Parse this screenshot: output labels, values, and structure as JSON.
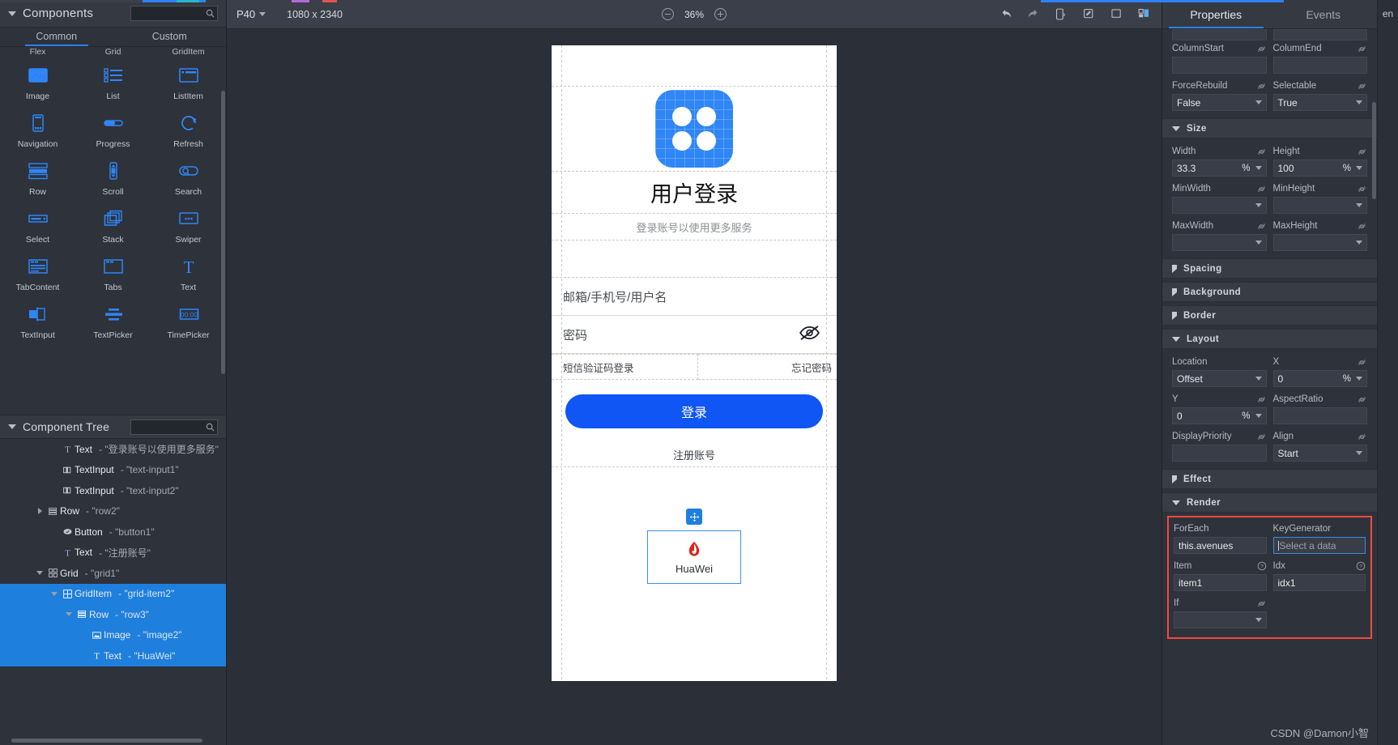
{
  "left_panel": {
    "components_title": "Components",
    "components_search_placeholder": "",
    "tabs": {
      "common": "Common",
      "custom": "Custom"
    },
    "row_labels": [
      "Flex",
      "Grid",
      "GridItem"
    ],
    "palette": [
      {
        "label": "Image",
        "icon": "image-icon"
      },
      {
        "label": "List",
        "icon": "list-icon"
      },
      {
        "label": "ListItem",
        "icon": "listitem-icon"
      },
      {
        "label": "Navigation",
        "icon": "navigation-icon"
      },
      {
        "label": "Progress",
        "icon": "progress-icon"
      },
      {
        "label": "Refresh",
        "icon": "refresh-icon"
      },
      {
        "label": "Row",
        "icon": "row-icon"
      },
      {
        "label": "Scroll",
        "icon": "scroll-icon"
      },
      {
        "label": "Search",
        "icon": "search-icon"
      },
      {
        "label": "Select",
        "icon": "select-icon"
      },
      {
        "label": "Stack",
        "icon": "stack-icon"
      },
      {
        "label": "Swiper",
        "icon": "swiper-icon"
      },
      {
        "label": "TabContent",
        "icon": "tabcontent-icon"
      },
      {
        "label": "Tabs",
        "icon": "tabs-icon"
      },
      {
        "label": "Text",
        "icon": "text-icon"
      },
      {
        "label": "TextInput",
        "icon": "textinput-icon"
      },
      {
        "label": "TextPicker",
        "icon": "textpicker-icon"
      },
      {
        "label": "TimePicker",
        "icon": "timepicker-icon"
      }
    ],
    "tree_title": "Component Tree",
    "tree_search_placeholder": "",
    "tree": [
      {
        "type": "Text",
        "value": "- \"登录账号以使用更多服务\"",
        "indent": 3,
        "caret": "",
        "icon": "text-icon",
        "selected": false
      },
      {
        "type": "TextInput",
        "value": "- \"text-input1\"",
        "indent": 3,
        "caret": "",
        "icon": "textinput-icon",
        "selected": false
      },
      {
        "type": "TextInput",
        "value": "- \"text-input2\"",
        "indent": 3,
        "caret": "",
        "icon": "textinput-icon",
        "selected": false
      },
      {
        "type": "Row",
        "value": "- \"row2\"",
        "indent": 2,
        "caret": "right",
        "icon": "row-icon",
        "selected": false
      },
      {
        "type": "Button",
        "value": "- \"button1\"",
        "indent": 3,
        "caret": "",
        "icon": "button-icon",
        "selected": false
      },
      {
        "type": "Text",
        "value": "- \"注册账号\"",
        "indent": 3,
        "caret": "",
        "icon": "text-icon",
        "selected": false
      },
      {
        "type": "Grid",
        "value": "- \"grid1\"",
        "indent": 2,
        "caret": "down",
        "icon": "grid-icon",
        "selected": false
      },
      {
        "type": "GridItem",
        "value": "- \"grid-item2\"",
        "indent": 3,
        "caret": "down",
        "icon": "griditem-icon",
        "selected": true
      },
      {
        "type": "Row",
        "value": "- \"row3\"",
        "indent": 4,
        "caret": "down",
        "icon": "row-icon",
        "selected": true
      },
      {
        "type": "Image",
        "value": "- \"image2\"",
        "indent": 5,
        "caret": "",
        "icon": "image-icon",
        "selected": true
      },
      {
        "type": "Text",
        "value": "- \"HuaWei\"",
        "indent": 5,
        "caret": "",
        "icon": "text-icon",
        "selected": true
      }
    ]
  },
  "toolbar": {
    "device": "P40",
    "resolution": "1080 x 2340",
    "zoom": "36%",
    "icons": [
      "undo-icon",
      "redo-icon",
      "device-preview-icon",
      "link-device-icon",
      "frame-icon",
      "restore-layout-icon"
    ]
  },
  "preview": {
    "title": "用户登录",
    "subtitle": "登录账号以使用更多服务",
    "account_placeholder": "邮箱/手机号/用户名",
    "password_placeholder": "密码",
    "sms_login": "短信验证码登录",
    "forgot_password": "忘记密码",
    "login_button": "登录",
    "register": "注册账号",
    "grid_item_brand": "HUAWEI",
    "grid_item_label": "HuaWei"
  },
  "properties": {
    "tabs": {
      "properties": "Properties",
      "events": "Events"
    },
    "fields_top": [
      {
        "label": "ColumnStart",
        "value": "",
        "type": "text",
        "link": true
      },
      {
        "label": "ColumnEnd",
        "value": "",
        "type": "text",
        "link": true
      },
      {
        "label": "ForceRebuild",
        "value": "False",
        "type": "select",
        "link": true
      },
      {
        "label": "Selectable",
        "value": "True",
        "type": "select",
        "link": true
      }
    ],
    "sections": {
      "size": "Size",
      "spacing": "Spacing",
      "background": "Background",
      "border": "Border",
      "layout": "Layout",
      "effect": "Effect",
      "render": "Render"
    },
    "size_fields": [
      {
        "label": "Width",
        "value": "33.3",
        "unit": "%",
        "type": "unit",
        "link": true
      },
      {
        "label": "Height",
        "value": "100",
        "unit": "%",
        "type": "unit",
        "link": true
      },
      {
        "label": "MinWidth",
        "value": "",
        "unit": "",
        "type": "select",
        "link": true
      },
      {
        "label": "MinHeight",
        "value": "",
        "unit": "",
        "type": "select",
        "link": true
      },
      {
        "label": "MaxWidth",
        "value": "",
        "unit": "",
        "type": "select",
        "link": true
      },
      {
        "label": "MaxHeight",
        "value": "",
        "unit": "",
        "type": "select",
        "link": true
      }
    ],
    "layout_fields": [
      {
        "label": "Location",
        "value": "Offset",
        "unit": "",
        "type": "select",
        "link": false
      },
      {
        "label": "X",
        "value": "0",
        "unit": "%",
        "type": "unit",
        "link": true
      },
      {
        "label": "Y",
        "value": "0",
        "unit": "%",
        "type": "unit",
        "link": true
      },
      {
        "label": "AspectRatio",
        "value": "",
        "unit": "",
        "type": "text",
        "link": true
      },
      {
        "label": "DisplayPriority",
        "value": "",
        "unit": "",
        "type": "text",
        "link": true
      },
      {
        "label": "Align",
        "value": "Start",
        "unit": "",
        "type": "select",
        "link": true
      }
    ],
    "render_fields": [
      {
        "label": "ForEach",
        "value": "this.avenues",
        "type": "text",
        "link": false
      },
      {
        "label": "KeyGenerator",
        "value": "",
        "placeholder": "Select a data",
        "type": "focus",
        "link": false
      },
      {
        "label": "Item",
        "value": "item1",
        "type": "text",
        "help": true
      },
      {
        "label": "Idx",
        "value": "idx1",
        "type": "text",
        "help": true
      },
      {
        "label": "If",
        "value": "",
        "type": "select",
        "link": true
      }
    ],
    "highlight_color": "#f4493f",
    "accent_color": "#2f81f7"
  },
  "far_right": {
    "label": "en"
  },
  "watermark": "CSDN @Damon小智"
}
